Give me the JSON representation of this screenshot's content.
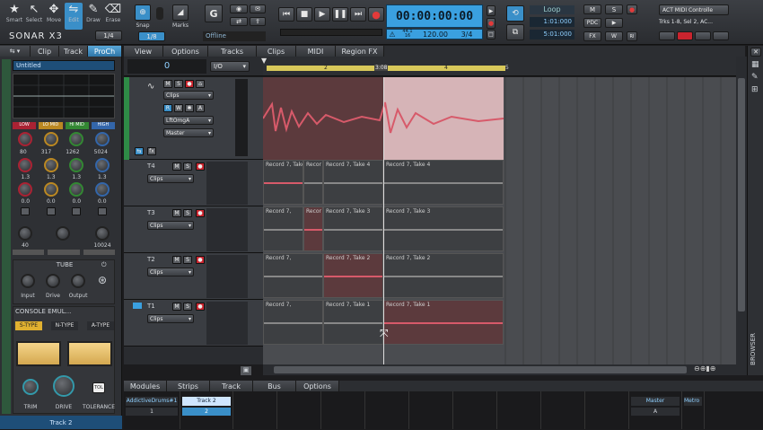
{
  "app": {
    "title": "SONAR X3"
  },
  "toolbar_tools": [
    {
      "name": "Smart",
      "icon": "star-icon",
      "glyph": "★"
    },
    {
      "name": "Select",
      "icon": "cursor-icon",
      "glyph": "↖"
    },
    {
      "name": "Move",
      "icon": "move-icon",
      "glyph": "✥"
    },
    {
      "name": "Edit",
      "icon": "edit-icon",
      "glyph": "⇋"
    },
    {
      "name": "Draw",
      "icon": "pencil-icon",
      "glyph": "✎"
    },
    {
      "name": "Erase",
      "icon": "eraser-icon",
      "glyph": "⌫"
    }
  ],
  "snap": {
    "label": "Snap",
    "value": "1/8",
    "grid": "1/4"
  },
  "marks": {
    "label": "Marks"
  },
  "sync": {
    "status": "Offline"
  },
  "transport": {
    "time": "00:00:00:00",
    "tempo": "120.00",
    "meter": "3/4",
    "sample_rate": "44.1",
    "bit_depth": "16"
  },
  "loop": {
    "label": "Loop",
    "start": "1:01:000",
    "end": "5:01:000"
  },
  "mix_buttons": {
    "m": "M",
    "s": "S",
    "pdc": "PDC",
    "fx": "FX",
    "w": "W",
    "ri": "RI"
  },
  "act": {
    "title": "ACT MIDI Controlle",
    "subtitle": "Trks 1-8, Sel 2, AC..."
  },
  "inspector_tabs": [
    "Clip",
    "Track",
    "ProCh"
  ],
  "inspector": {
    "track_name": "Untitled",
    "eq_bands": [
      "LOW",
      "LO MID",
      "HI MID",
      "HIGH"
    ],
    "eq_freqs": [
      "80",
      "317",
      "1262",
      "5024"
    ],
    "eq_gain": [
      "1.3",
      "1.3",
      "1.3",
      "1.3"
    ],
    "eq_q": [
      "0.0",
      "0.0",
      "0.0",
      "0.0"
    ],
    "filter_vals": [
      "40",
      "",
      "10024"
    ],
    "tube": {
      "title": "TUBE",
      "knobs": [
        "Input",
        "Drive",
        "Output"
      ]
    },
    "console": {
      "title": "CONSOLE EMUL...",
      "types": [
        "S-TYPE",
        "N-TYPE",
        "A-TYPE"
      ],
      "knobs": [
        "TRIM",
        "DRIVE",
        "TOLERANCE"
      ],
      "tol": "TOL"
    },
    "footer": "Track 2"
  },
  "track_menu": [
    "View",
    "Options",
    "Tracks",
    "Clips",
    "MIDI",
    "Region FX"
  ],
  "track_top": {
    "value": "0",
    "io": "I/O"
  },
  "ruler": {
    "marks": [
      "2",
      "3",
      "3:08",
      "4",
      "5"
    ]
  },
  "tracks": [
    {
      "id": "T5",
      "name": "",
      "dropdown": "Clips",
      "input": "LftOmgA",
      "output": "Master",
      "expanded": true
    },
    {
      "id": "T4",
      "name": "T4",
      "dropdown": "Clips"
    },
    {
      "id": "T3",
      "name": "T3",
      "dropdown": "Clips"
    },
    {
      "id": "T2",
      "name": "T2",
      "dropdown": "Clips"
    },
    {
      "id": "T1",
      "name": "T1",
      "dropdown": "Clips"
    }
  ],
  "clips": {
    "t4": [
      "Record 7, Take 4",
      "Recor",
      "Record 7, Take 4",
      "Record 7, Take 4"
    ],
    "t3": [
      "Record 7,",
      "Recor",
      "Record 7, Take 3",
      "Record 7, Take 3"
    ],
    "t2": [
      "Record 7,",
      "Record 7, Take 2",
      "Record 7, Take 2"
    ],
    "t1": [
      "Record 7,",
      "Record 7, Take 1",
      "Record 7, Take 1"
    ]
  },
  "mixer_menu": [
    "Modules",
    "Strips",
    "Track",
    "Bus",
    "Options"
  ],
  "mixer_strips": [
    {
      "name": "AddictiveDrums#1",
      "num": "1"
    },
    {
      "name": "Track 2",
      "num": "2"
    }
  ],
  "master_strips": [
    {
      "name": "Master",
      "num": "A"
    },
    {
      "name": "Metro",
      "num": ""
    }
  ],
  "browser": {
    "label": "BROWSER"
  },
  "colors": {
    "accent": "#3aa0e0",
    "clip_red": "#d75a6a",
    "record": "#c9242e"
  }
}
